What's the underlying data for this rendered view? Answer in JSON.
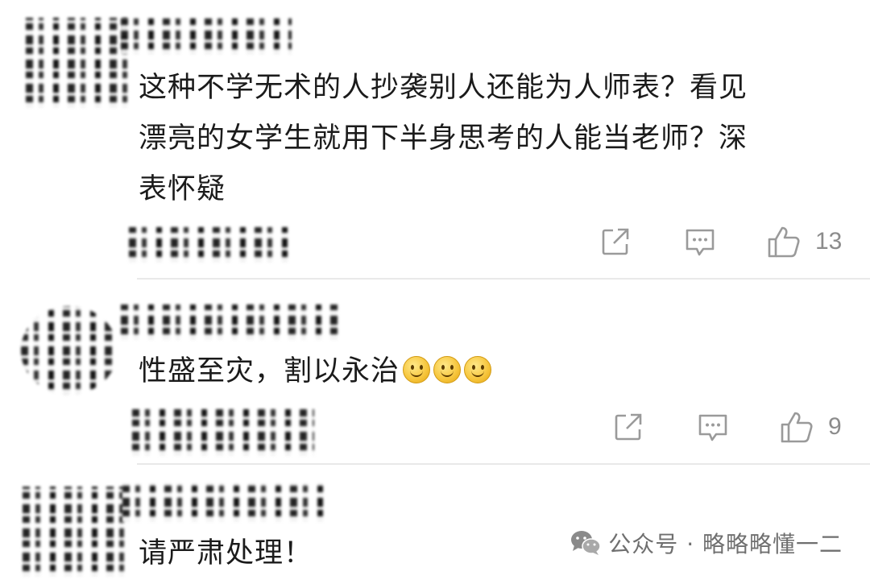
{
  "comments": [
    {
      "text_lines": [
        "这种不学无术的人抄袭别人还能为人师表？看见",
        "漂亮的女学生就用下半身思考的人能当老师？深",
        "表怀疑"
      ],
      "like_count": "13"
    },
    {
      "text": "性盛至灾，割以永治",
      "emoji": "smile-emoji",
      "emoji_count": 3,
      "like_count": "9"
    },
    {
      "text": "请严肃处理！"
    }
  ],
  "icons": {
    "share": "share-icon",
    "reply": "comment-icon",
    "like": "thumbs-up-icon"
  },
  "watermark": {
    "text": "公众号 · 略略略懂一二",
    "logo": "wechat-icon"
  },
  "colors": {
    "text": "#1b1b1b",
    "icon": "#9a9a9a",
    "divider": "#e9e9e9"
  }
}
